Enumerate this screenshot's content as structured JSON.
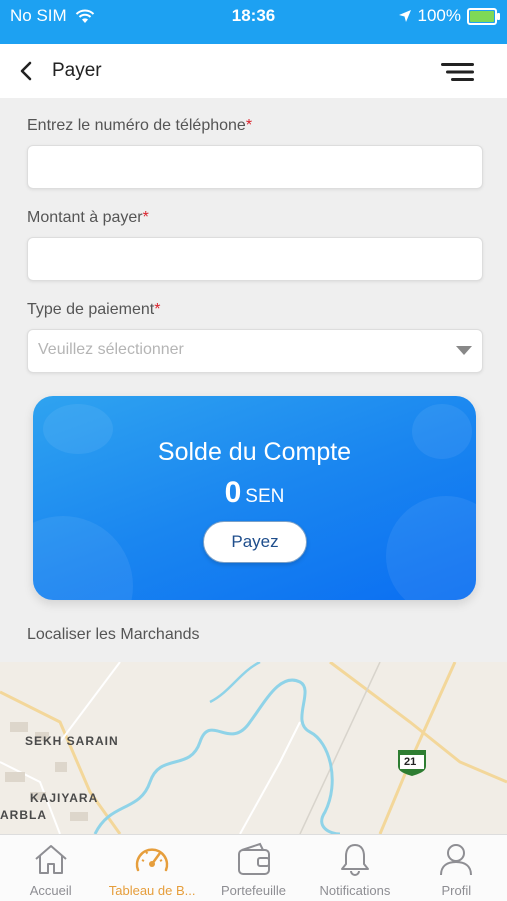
{
  "status_bar": {
    "carrier": "No SIM",
    "time": "18:36",
    "battery": "100%"
  },
  "header": {
    "title": "Payer"
  },
  "form": {
    "phone_label": "Entrez le numéro de téléphone",
    "phone_value": "",
    "amount_label": "Montant à payer",
    "amount_value": "",
    "payment_type_label": "Type de paiement",
    "payment_type_placeholder": "Veuillez sélectionner",
    "required_mark": "*"
  },
  "balance_card": {
    "title": "Solde du Compte",
    "amount": "0",
    "currency": "SEN",
    "pay_button": "Payez"
  },
  "merchants": {
    "label": "Localiser les Marchands",
    "map_labels": [
      "SEKH SARAIN",
      "KAJIYARA",
      "ARBLA"
    ],
    "route_shield": "21"
  },
  "tab_bar": {
    "items": [
      {
        "label": "Accueil",
        "icon": "home-icon",
        "active": false
      },
      {
        "label": "Tableau de B...",
        "icon": "dashboard-icon",
        "active": true
      },
      {
        "label": "Portefeuille",
        "icon": "wallet-icon",
        "active": false
      },
      {
        "label": "Notifications",
        "icon": "bell-icon",
        "active": false
      },
      {
        "label": "Profil",
        "icon": "user-icon",
        "active": false
      }
    ]
  },
  "colors": {
    "primary": "#1da1f2",
    "active_tab": "#e69e3c",
    "required": "#d9232d"
  }
}
